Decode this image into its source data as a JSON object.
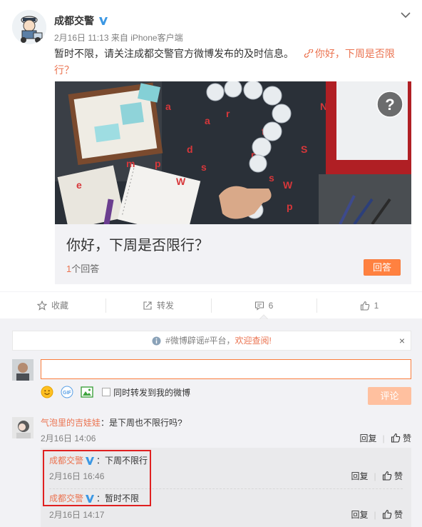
{
  "post": {
    "author": "成都交警",
    "date": "2月16日 11:13",
    "source_prefix": "来自",
    "source": "iPhone客户端",
    "text": "暂时不限，请关注成都交警官方微博发布的及时信息。",
    "link_text_line1": "你好，下周是否限",
    "link_text_line2": "行？"
  },
  "question": {
    "title": "你好，下周是否限行？",
    "answer_count": "1",
    "answer_suffix": "个回答",
    "answer_button": "回答"
  },
  "actions": {
    "favorite": "收藏",
    "repost": "转发",
    "comment_count": "6",
    "like_count": "1"
  },
  "notice": {
    "prefix": "#微博辟谣#平台，",
    "highlight": "欢迎查阅!",
    "close": "×"
  },
  "composer": {
    "repost_label": "同时转发到我的微博",
    "submit": "评论"
  },
  "comment": {
    "user": "气泡里的吉娃娃",
    "text": "：是下周也不限行吗?",
    "time": "2月16日 14:06",
    "reply": "回复",
    "like": "赞"
  },
  "replies": [
    {
      "user": "成都交警",
      "text": "：下周不限行",
      "time": "2月16日 16:46",
      "reply": "回复",
      "like": "赞"
    },
    {
      "user": "成都交警",
      "text": "：暂时不限",
      "time": "2月16日 14:17",
      "reply": "回复",
      "like": "赞"
    }
  ],
  "colors": {
    "accent": "#eb7350",
    "button": "#ff8140",
    "verified": "#3b97e3",
    "highlight_box": "#e02020"
  }
}
